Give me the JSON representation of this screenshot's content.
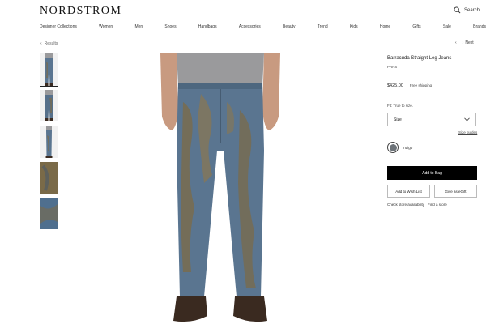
{
  "header": {
    "logo": "NORDSTROM",
    "search_label": "Search"
  },
  "nav": [
    "Designer Collections",
    "Women",
    "Men",
    "Shoes",
    "Handbags",
    "Accessories",
    "Beauty",
    "Trend",
    "Kids",
    "Home",
    "Gifts",
    "Sale",
    "Brands"
  ],
  "breadcrumb": {
    "back_label": "Results",
    "next_label": "Next"
  },
  "product": {
    "title": "Barracuda Straight Leg Jeans",
    "brand": "PRPS",
    "price": "$425.00",
    "shipping": "Free shipping",
    "fit": "Fit: True to size.",
    "size_placeholder": "Size",
    "size_guide": "Size guides",
    "color_name": "Indigo",
    "add_to_bag": "Add to Bag",
    "add_wishlist": "Add to Wish List",
    "give_egift": "Give as eGift",
    "check_store": "Check store availability",
    "find_store": "Find a store"
  },
  "colors": {
    "denim": "#5a7590",
    "mud": "#7b6b4a",
    "shirt": "#9a9a9c",
    "skin": "#c89a80",
    "boot": "#3a2a20"
  }
}
